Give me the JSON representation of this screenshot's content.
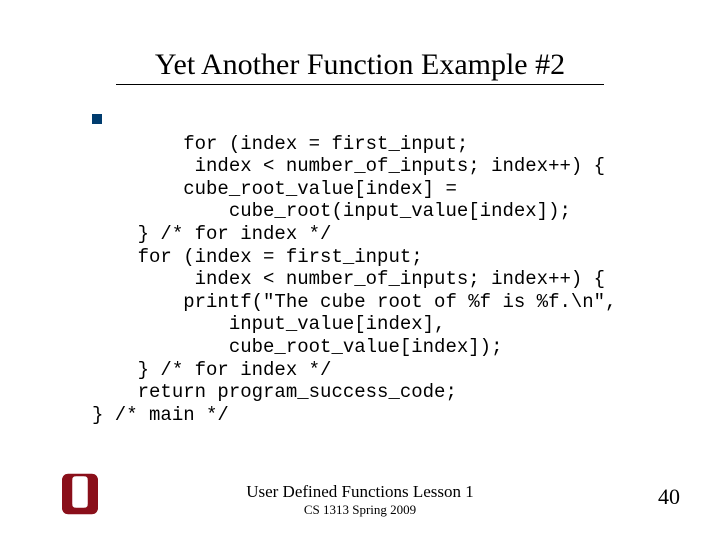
{
  "title": "Yet Another Function Example #2",
  "code": "    for (index = first_input;\n         index < number_of_inputs; index++) {\n        cube_root_value[index] =\n            cube_root(input_value[index]);\n    } /* for index */\n    for (index = first_input;\n         index < number_of_inputs; index++) {\n        printf(\"The cube root of %f is %f.\\n\",\n            input_value[index],\n            cube_root_value[index]);\n    } /* for index */\n    return program_success_code;\n} /* main */",
  "footer": {
    "lesson": "User Defined Functions Lesson 1",
    "course": "CS 1313 Spring 2009"
  },
  "page_number": "40",
  "logo": {
    "name": "ou-logo"
  }
}
